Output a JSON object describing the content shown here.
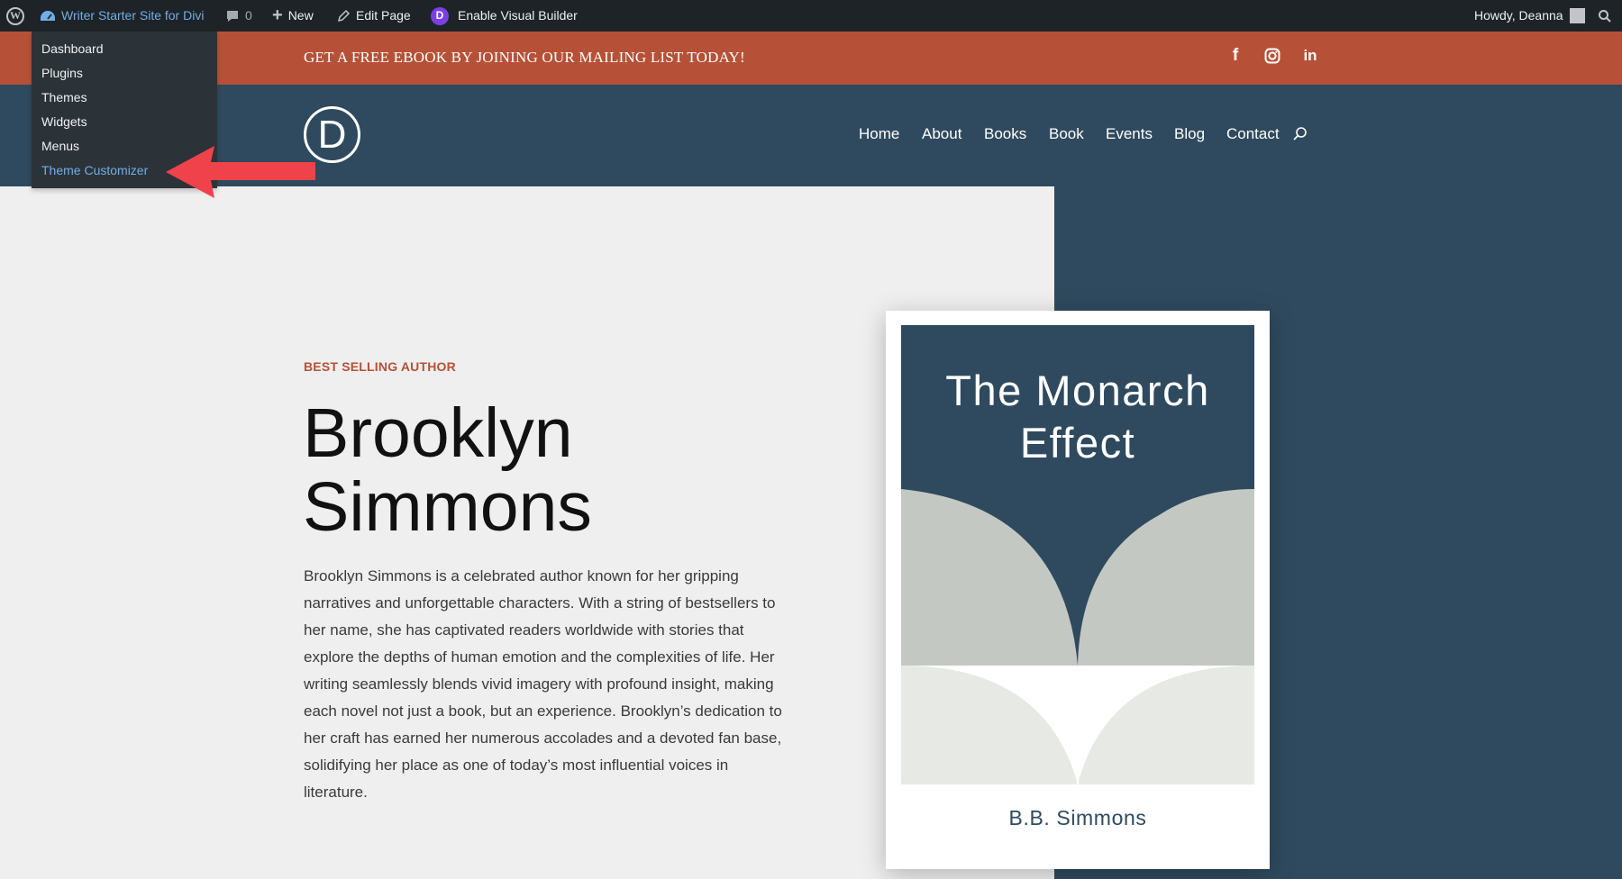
{
  "adminbar": {
    "site_name": "Writer Starter Site for Divi",
    "comments_count": "0",
    "new_label": "New",
    "edit_label": "Edit Page",
    "visual_builder_label": "Enable Visual Builder",
    "divi_glyph": "D",
    "greeting": "Howdy, Deanna"
  },
  "site_menu": {
    "items": [
      {
        "label": "Dashboard"
      },
      {
        "label": "Plugins"
      },
      {
        "label": "Themes"
      },
      {
        "label": "Widgets"
      },
      {
        "label": "Menus"
      },
      {
        "label": "Theme Customizer",
        "highlighted": true
      }
    ]
  },
  "topbar": {
    "promo": "GET A FREE EBOOK BY JOINING OUR MAILING LIST TODAY!",
    "social": [
      {
        "icon": "facebook-icon",
        "glyph": "f"
      },
      {
        "icon": "instagram-icon",
        "glyph": ""
      },
      {
        "icon": "linkedin-icon",
        "glyph": "in"
      }
    ]
  },
  "header": {
    "logo_letter": "D",
    "nav": [
      {
        "label": "Home"
      },
      {
        "label": "About"
      },
      {
        "label": "Books"
      },
      {
        "label": "Book"
      },
      {
        "label": "Events"
      },
      {
        "label": "Blog"
      },
      {
        "label": "Contact"
      }
    ]
  },
  "hero": {
    "eyebrow": "BEST SELLING AUTHOR",
    "title_line1": "Brooklyn",
    "title_line2": "Simmons",
    "bio": "Brooklyn Simmons is a celebrated author known for her gripping narratives and unforgettable characters. With a string of bestsellers to her name, she has captivated readers worldwide with stories that explore the depths of human emotion and the complexities of life. Her writing seamlessly blends vivid imagery with profound insight, making each novel not just a book, but an experience. Brooklyn’s dedication to her craft has earned her numerous accolades and a devoted fan base, solidifying her place as one of today’s most influential voices in literature."
  },
  "book": {
    "title_line1": "The Monarch",
    "title_line2": "Effect",
    "author": "B.B. Simmons"
  },
  "colors": {
    "admin_bar": "#1d2327",
    "accent": "#b65137",
    "navy": "#2f4a5e",
    "highlight_link": "#72aee6",
    "arrow": "#f0424b"
  }
}
